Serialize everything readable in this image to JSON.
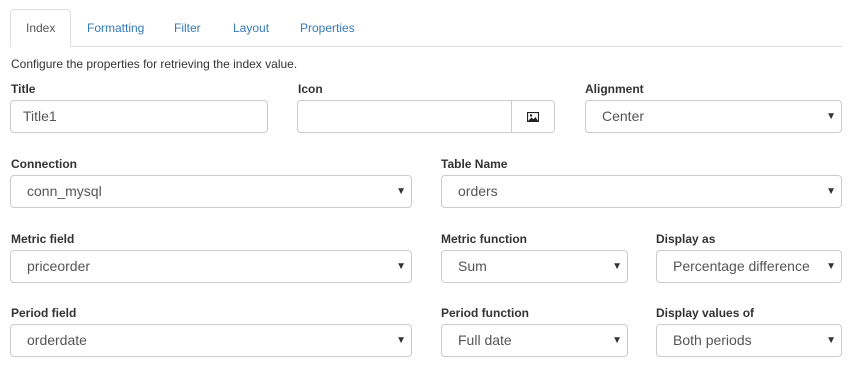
{
  "tabs": [
    {
      "label": "Index",
      "active": true
    },
    {
      "label": "Formatting"
    },
    {
      "label": "Filter"
    },
    {
      "label": "Layout"
    },
    {
      "label": "Properties"
    }
  ],
  "intro": "Configure the properties for retrieving the index value.",
  "fields": {
    "title": {
      "label": "Title",
      "value": "Title1"
    },
    "icon": {
      "label": "Icon",
      "value": "",
      "button_icon": "image-icon"
    },
    "alignment": {
      "label": "Alignment",
      "value": "Center"
    },
    "connection": {
      "label": "Connection",
      "value": "conn_mysql"
    },
    "table_name": {
      "label": "Table Name",
      "value": "orders"
    },
    "metric_field": {
      "label": "Metric field",
      "value": "priceorder"
    },
    "metric_function": {
      "label": "Metric function",
      "value": "Sum"
    },
    "display_as": {
      "label": "Display as",
      "value": "Percentage difference"
    },
    "period_field": {
      "label": "Period field",
      "value": "orderdate"
    },
    "period_function": {
      "label": "Period function",
      "value": "Full date"
    },
    "display_values_of": {
      "label": "Display values of",
      "value": "Both periods"
    }
  },
  "colors": {
    "link": "#337ab7",
    "border": "#cccccc",
    "text": "#555555"
  }
}
